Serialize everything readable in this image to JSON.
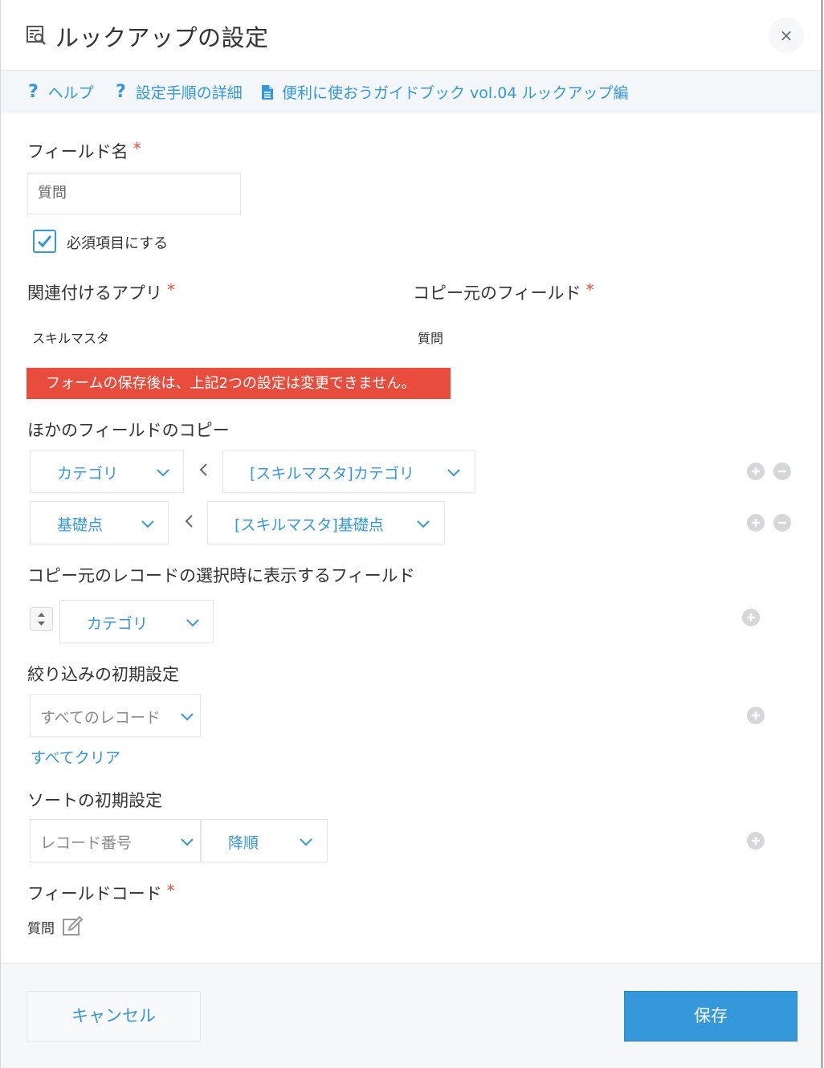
{
  "header": {
    "title": "ルックアップの設定",
    "close_label": "×"
  },
  "helpbar": {
    "help": "ヘルプ",
    "steps": "設定手順の詳細",
    "guide": "便利に使おうガイドブック vol.04 ルックアップ編"
  },
  "field_name": {
    "label": "フィールド名",
    "required_mark": "*",
    "value": "質問"
  },
  "required_checkbox": {
    "label": "必須項目にする",
    "checked": true
  },
  "related_app": {
    "label": "関連付けるアプリ",
    "required_mark": "*",
    "value": "スキルマスタ"
  },
  "source_field": {
    "label": "コピー元のフィールド",
    "required_mark": "*",
    "value": "質問"
  },
  "alert": "フォームの保存後は、上記2つの設定は変更できません。",
  "copy_fields": {
    "label": "ほかのフィールドのコピー",
    "rows": [
      {
        "target": "カテゴリ",
        "source": "[スキルマスタ]カテゴリ"
      },
      {
        "target": "基礎点",
        "source": "[スキルマスタ]基礎点"
      }
    ]
  },
  "display_fields": {
    "label": "コピー元のレコードの選択時に表示するフィールド",
    "items": [
      "カテゴリ"
    ]
  },
  "filter": {
    "label": "絞り込みの初期設定",
    "value": "すべてのレコード",
    "clear_link": "すべてクリア"
  },
  "sort": {
    "label": "ソートの初期設定",
    "field": "レコード番号",
    "order": "降順"
  },
  "field_code": {
    "label": "フィールドコード",
    "required_mark": "*",
    "value": "質問"
  },
  "footer": {
    "cancel": "キャンセル",
    "save": "保存"
  },
  "colors": {
    "accent": "#3498db",
    "alert": "#e74c3c",
    "required": "#e74c3c"
  }
}
